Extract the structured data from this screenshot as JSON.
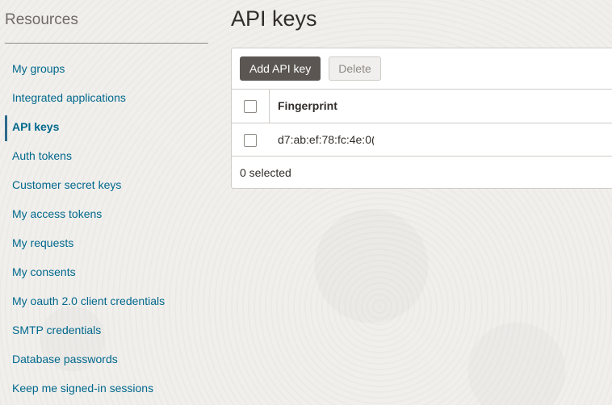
{
  "sidebar": {
    "title": "Resources",
    "items": [
      {
        "label": "My groups"
      },
      {
        "label": "Integrated applications"
      },
      {
        "label": "API keys"
      },
      {
        "label": "Auth tokens"
      },
      {
        "label": "Customer secret keys"
      },
      {
        "label": "My access tokens"
      },
      {
        "label": "My requests"
      },
      {
        "label": "My consents"
      },
      {
        "label": "My oauth 2.0 client credentials"
      },
      {
        "label": "SMTP credentials"
      },
      {
        "label": "Database passwords"
      },
      {
        "label": "Keep me signed-in sessions"
      }
    ],
    "active_item": "API keys"
  },
  "main": {
    "title": "API keys",
    "toolbar": {
      "add_label": "Add API key",
      "delete_label": "Delete"
    },
    "table": {
      "columns": [
        "Fingerprint"
      ],
      "rows": [
        {
          "fingerprint": "d7:ab:ef:78:fc:4e:0("
        }
      ],
      "footer": "0 selected"
    }
  },
  "colors": {
    "link": "#00688c",
    "primary_button": "#5b5652",
    "background": "#f1efec"
  }
}
